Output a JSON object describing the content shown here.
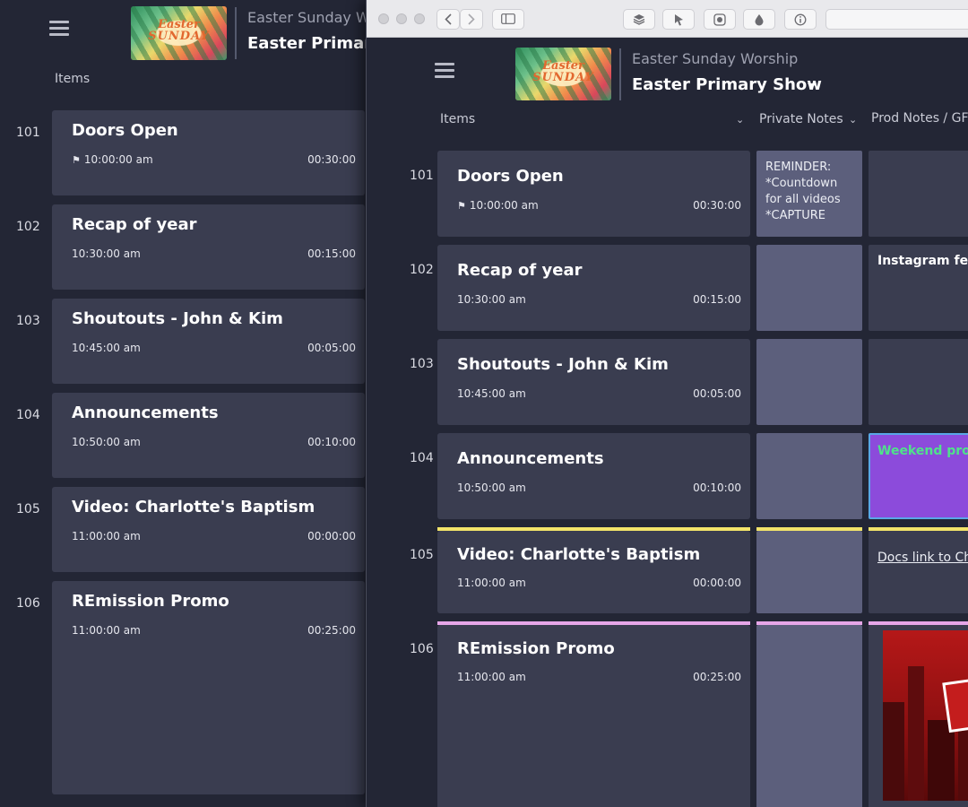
{
  "app": {
    "event_name": "Easter Sunday Worship",
    "show_name": "Easter Primary Show",
    "thumbnail_text_line1": "Easter",
    "thumbnail_text_line2": "SUNDAY"
  },
  "back_window": {
    "event_name_visible": "Easter Sunday Wo",
    "show_name_visible": "Easter Primary",
    "items_label": "Items"
  },
  "columns": {
    "items": "Items",
    "private_notes": "Private Notes",
    "prod_notes": "Prod Notes / GFX"
  },
  "rows": [
    {
      "number": "101",
      "title": "Doors Open",
      "start": "10:00:00 am",
      "duration": "00:30:00",
      "has_flag": true,
      "private_note": "REMINDER: *Countdown for all videos *CAPTURE",
      "prod_note": ""
    },
    {
      "number": "102",
      "title": "Recap of year",
      "start": "10:30:00 am",
      "duration": "00:15:00",
      "has_flag": false,
      "private_note": "",
      "prod_note": "Instagram fee"
    },
    {
      "number": "103",
      "title": "Shoutouts - John & Kim",
      "start": "10:45:00 am",
      "duration": "00:05:00",
      "has_flag": false,
      "private_note": "",
      "prod_note": ""
    },
    {
      "number": "104",
      "title": "Announcements",
      "start": "10:50:00 am",
      "duration": "00:10:00",
      "has_flag": false,
      "private_note": "",
      "prod_note": "Weekend prom"
    },
    {
      "number": "105",
      "title": "Video: Charlotte's Baptism",
      "start": "11:00:00 am",
      "duration": "00:00:00",
      "has_flag": false,
      "private_note": "",
      "prod_note": "Docs link to Cha"
    },
    {
      "number": "106",
      "title": "REmission Promo",
      "start": "11:00:00 am",
      "duration": "00:25:00",
      "has_flag": false,
      "private_note": "",
      "prod_note": ""
    }
  ],
  "colors": {
    "background": "#232635",
    "card": "#3a3d50",
    "note_cell": "#5c5f7c",
    "highlight_purple": "#8c4bdb",
    "highlight_green_text": "#4fe38a",
    "row_bar_yellow": "#f3e46a",
    "row_bar_pink": "#e6a6e8"
  },
  "icons": {
    "menu": "hamburger-icon",
    "flag": "flag-icon",
    "dropdown": "caret-down-icon"
  }
}
